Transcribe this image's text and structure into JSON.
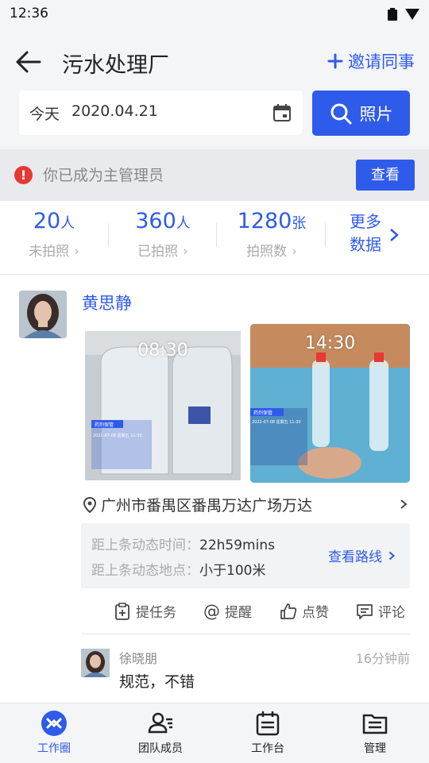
{
  "status_bar": {
    "time": "12:36"
  },
  "header": {
    "title": "污水处理厂",
    "invite_label": "邀请同事",
    "date_label": "今天",
    "date_value": "2020.04.21",
    "photo_button": "照片"
  },
  "notice": {
    "text": "你已成为主管理员",
    "button": "查看"
  },
  "stats": [
    {
      "value": "20",
      "unit": "人",
      "label": "未拍照"
    },
    {
      "value": "360",
      "unit": "人",
      "label": "已拍照"
    },
    {
      "value": "1280",
      "unit": "张",
      "label": "拍照数"
    }
  ],
  "more_data": {
    "line1": "更多",
    "line2": "数据"
  },
  "post": {
    "user": "黄思静",
    "photos": [
      {
        "time": "08:30",
        "caption": "药剂保管",
        "date": "2022-07-08 星期五 11:30"
      },
      {
        "time": "14:30",
        "caption": "药剂保管",
        "date": "2022-07-08 星期五 11:30"
      }
    ],
    "location": "广州市番禺区番禺万达广场万达",
    "last_time_label": "距上条动态时间：",
    "last_time_value": "22h59mins",
    "last_place_label": "距上条动态地点：",
    "last_place_value": "小于100米",
    "route_link": "查看路线",
    "actions": {
      "task": "提任务",
      "remind": "提醒",
      "like": "点赞",
      "comment": "评论"
    },
    "comment": {
      "user": "徐晓朋",
      "time": "16分钟前",
      "text": "规范，不错"
    }
  },
  "tabbar": [
    {
      "label": "工作圈",
      "active": true
    },
    {
      "label": "团队成员",
      "active": false
    },
    {
      "label": "工作台",
      "active": false
    },
    {
      "label": "管理",
      "active": false
    }
  ],
  "colors": {
    "accent": "#2f5bea",
    "alert": "#e53935",
    "background": "#f4f5f7"
  }
}
